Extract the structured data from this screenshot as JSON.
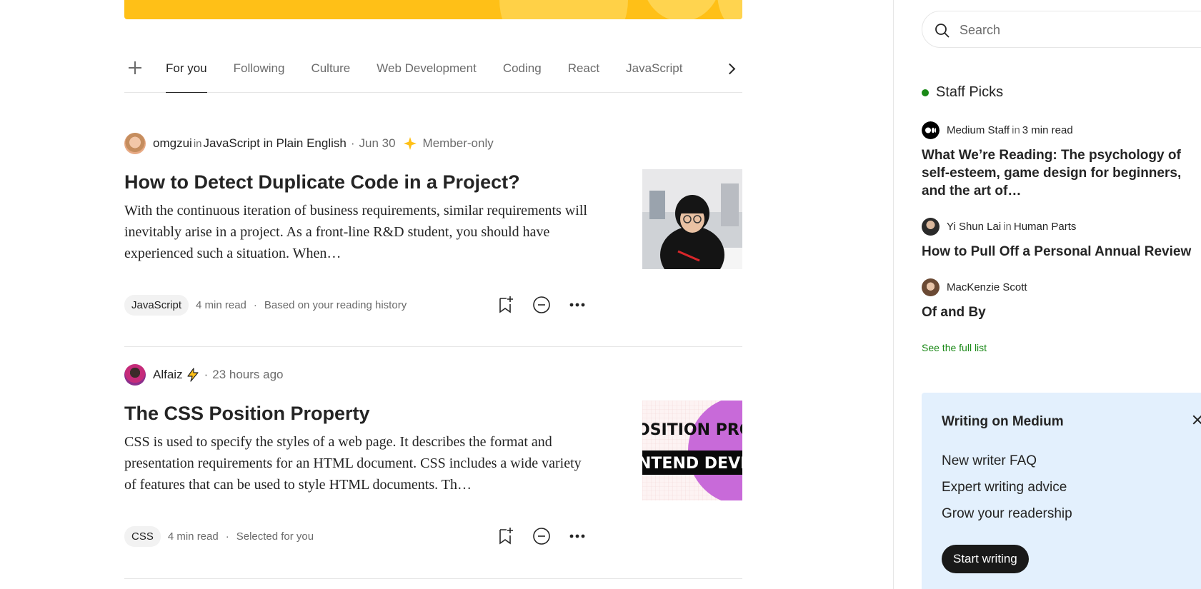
{
  "colors": {
    "brand_yellow": "#ffc017",
    "accent_green": "#1a8917",
    "text_primary": "#242424",
    "text_muted": "#6b6b6b",
    "writing_bg": "#e3f0fd"
  },
  "tabs": {
    "add_icon": "plus-icon",
    "next_icon": "chevron-right-icon",
    "items": [
      "For you",
      "Following",
      "Culture",
      "Web Development",
      "Coding",
      "React",
      "JavaScript"
    ],
    "active": "For you"
  },
  "articles": [
    {
      "author": "omgzui",
      "in_label": "in",
      "publication": "JavaScript in Plain English",
      "date": "Jun 30",
      "badge": "Member-only",
      "title": "How to Detect Duplicate Code in a Project?",
      "excerpt": "With the continuous iteration of business requirements, similar requirements will inevitably arise in a project. As a front-line R&D student, you should have experienced such a situation. When…",
      "tag": "JavaScript",
      "read_time": "4 min read",
      "reason": "Based on your reading history"
    },
    {
      "author": "Alfaiz",
      "date": "23 hours ago",
      "title": "The CSS Position Property",
      "excerpt": "CSS is used to specify the styles of a web page. It describes the format and presentation requirements for an HTML document. CSS includes a wide variety of features that can be used to style HTML documents. Th…",
      "thumb_text_1": "OSITION PROP",
      "thumb_text_2": "NTEND DEVELO",
      "tag": "CSS",
      "read_time": "4 min read",
      "reason": "Selected for you"
    }
  ],
  "sidebar": {
    "search_placeholder": "Search",
    "staff_picks_title": "Staff Picks",
    "picks": [
      {
        "author": "Medium Staff",
        "in_label": "in",
        "publication": "3 min read",
        "title": "What We’re Reading: The psychology of self-esteem, game design for beginners, and the art of…"
      },
      {
        "author": "Yi Shun Lai",
        "in_label": "in",
        "publication": "Human Parts",
        "title": "How to Pull Off a Personal Annual Review"
      },
      {
        "author": "MacKenzie Scott",
        "title": "Of and By"
      }
    ],
    "full_list_link": "See the full list",
    "writing": {
      "title": "Writing on Medium",
      "links": [
        "New writer FAQ",
        "Expert writing advice",
        "Grow your readership"
      ],
      "cta": "Start writing"
    }
  }
}
